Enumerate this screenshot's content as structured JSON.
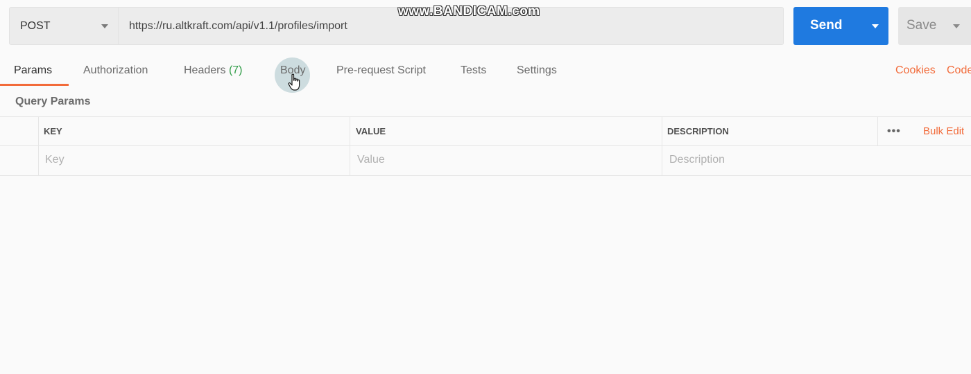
{
  "watermark": "www.BANDICAM.com",
  "request": {
    "method": "POST",
    "url": "https://ru.altkraft.com/api/v1.1/profiles/import",
    "send_label": "Send",
    "save_label": "Save"
  },
  "tabs": [
    {
      "label": "Params",
      "active": true
    },
    {
      "label": "Authorization"
    },
    {
      "label": "Headers",
      "count": "(7)"
    },
    {
      "label": "Body",
      "hovered": true
    },
    {
      "label": "Pre-request Script"
    },
    {
      "label": "Tests"
    },
    {
      "label": "Settings"
    }
  ],
  "right_links": {
    "cookies": "Cookies",
    "code": "Code"
  },
  "query_params": {
    "title": "Query Params",
    "columns": [
      "KEY",
      "VALUE",
      "DESCRIPTION"
    ],
    "bulk_edit": "Bulk Edit",
    "more": "•••",
    "placeholders": {
      "key": "Key",
      "value": "Value",
      "description": "Description"
    }
  },
  "colors": {
    "accent": "#f26b3a",
    "send": "#1f7ae0",
    "count": "#2f9c46"
  }
}
